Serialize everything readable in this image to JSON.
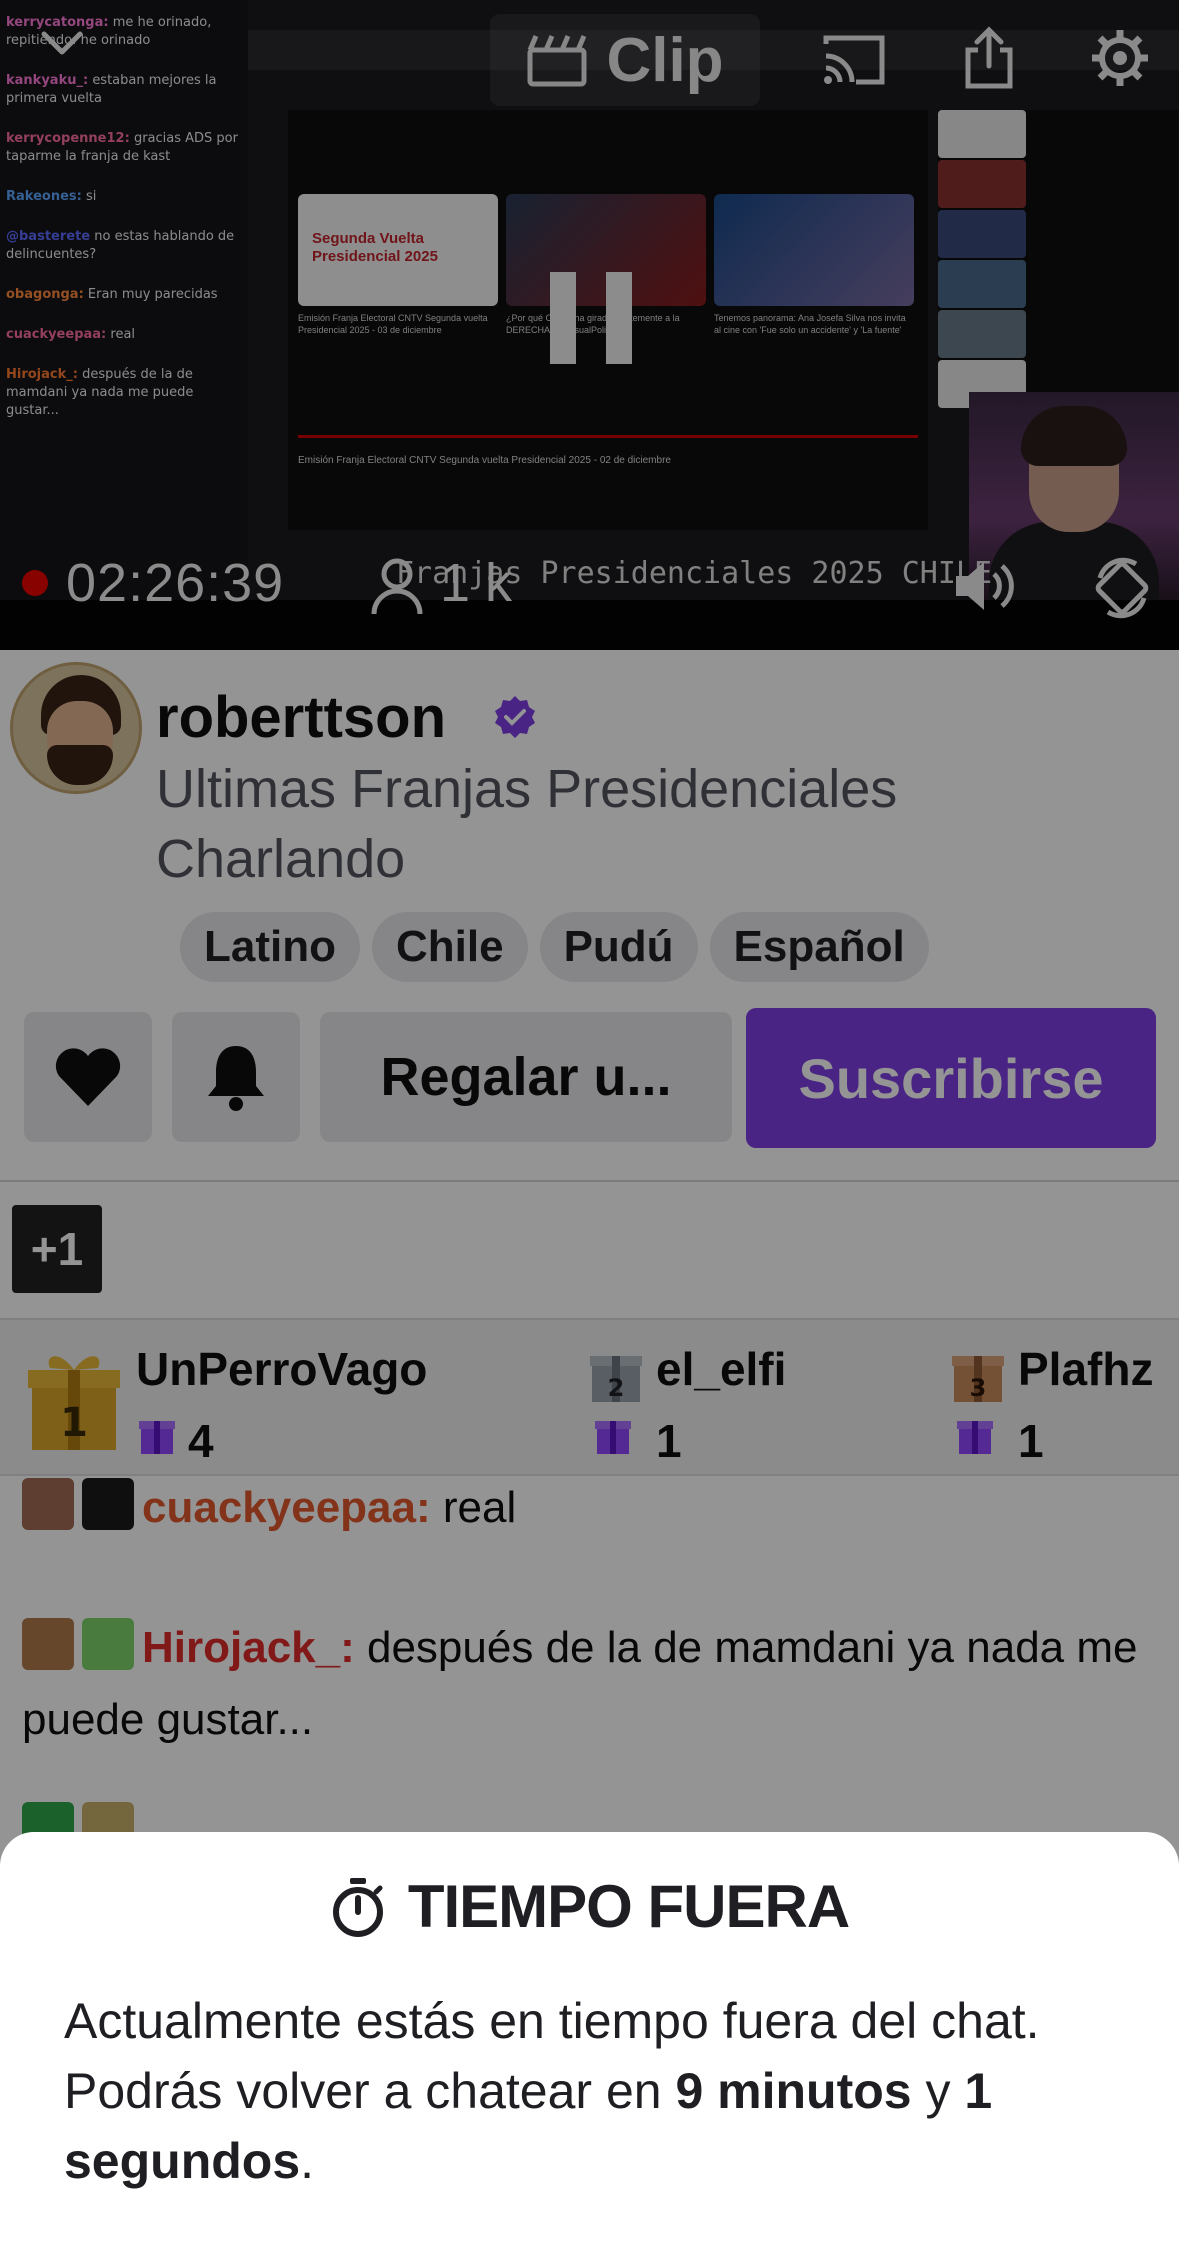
{
  "player": {
    "clip_label": "Clip",
    "live_time": "02:26:39",
    "viewer_count": "1 k",
    "overlay_title": "Franjas Presidenciales 2025 CHILE",
    "live_color": "#eb0400"
  },
  "stream_chat": [
    {
      "user": "kerrycatonga:",
      "text": "me he orinado, repitiendo: he orinado",
      "color": "#ff7ad9"
    },
    {
      "user": "kankyaku_:",
      "text": "estaban mejores la primera vuelta",
      "color": "#ff7ad9"
    },
    {
      "user": "kerrycopenne12:",
      "text": "gracias ADS por taparme la franja de kast",
      "color": "#ff6fa0"
    },
    {
      "user": "Rakeones:",
      "text": "si",
      "color": "#5ea6ff"
    },
    {
      "user": "@basterete",
      "text": "no estas hablando de delincuentes?",
      "color": "#5e6bff"
    },
    {
      "user": "obagonga:",
      "text": "Eran muy parecidas",
      "color": "#ff8a3d"
    },
    {
      "user": "cuackyeepaa:",
      "text": "real",
      "color": "#ff6fa0"
    },
    {
      "user": "Hirojack_:",
      "text": "después de la de mamdani ya nada me puede gustar...",
      "color": "#ff7a2f"
    }
  ],
  "youtube": {
    "caption_1": "Emisión Franja Electoral CNTV Segunda vuelta Presidencial 2025 - 03 de diciembre",
    "caption_2": "¿Por qué CHILE ha girado fuertemente a la DERECHA? @VisualPolitik",
    "caption_3": "Tenemos panorama: Ana Josefa Silva nos invita al cine con 'Fue solo un accidente' y 'La fuente'",
    "main_caption": "Emisión Franja Electoral CNTV Segunda vuelta Presidencial 2025 - 02 de diciembre",
    "thumb_text": "Segunda Vuelta Presidencial 2025"
  },
  "channel": {
    "name": "roberttson",
    "title": "Ultimas Franjas Presidenciales Charlando",
    "tags": [
      "Latino",
      "Chile",
      "Pudú",
      "Español"
    ],
    "gift_label": "Regalar u...",
    "subscribe_label": "Suscribirse",
    "badge_count": "+1",
    "accent_color": "#7e3fe4"
  },
  "leaderboard": [
    {
      "rank": "1",
      "name": "UnPerroVago",
      "count": "4"
    },
    {
      "rank": "2",
      "name": "el_elfi",
      "count": "1"
    },
    {
      "rank": "3",
      "name": "Plafhz",
      "count": "1"
    }
  ],
  "chat": [
    {
      "user": "cuackyeepaa:",
      "text": " real",
      "color": "#e0582c"
    },
    {
      "user": "Hirojack_:",
      "text": " después de la de mamdani ya nada me puede gustar...",
      "color": "#e02c2c"
    }
  ],
  "timeout_sheet": {
    "title": "TIEMPO FUERA",
    "text_before": "Actualmente estás en tiempo fuera del chat. Podrás volver a chatear en ",
    "minutes": "9 minutos",
    "joiner": " y ",
    "seconds": "1 segundos",
    "text_after": "."
  }
}
